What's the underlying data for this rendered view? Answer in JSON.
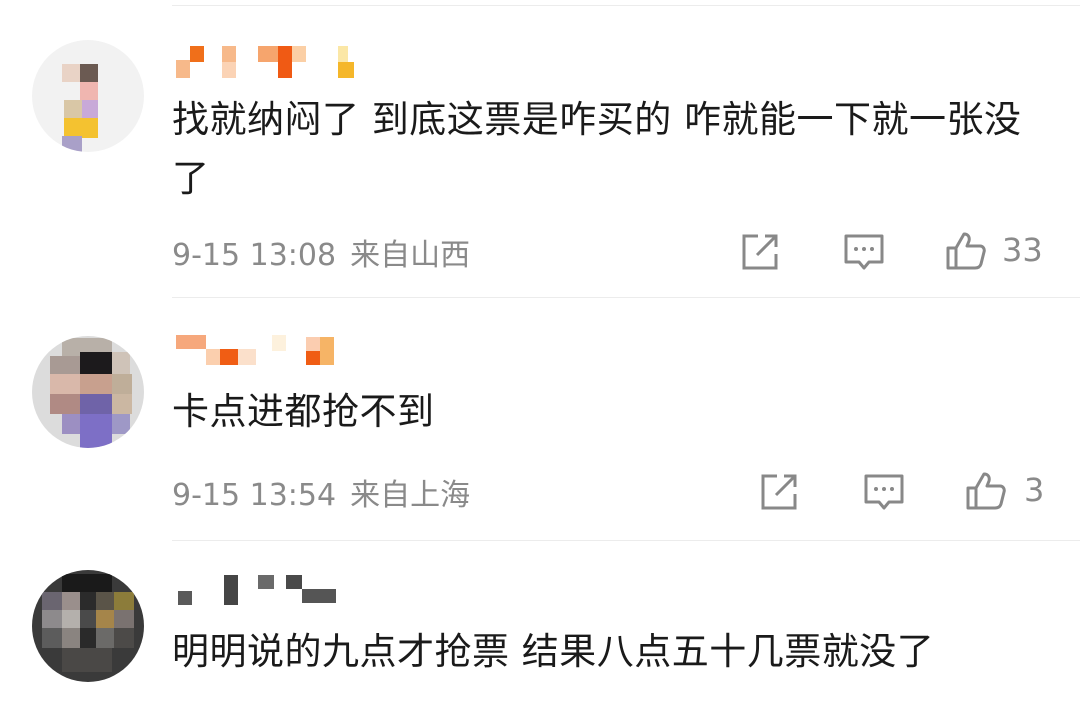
{
  "comments": [
    {
      "username": "",
      "text": "找就纳闷了 到底这票是咋买的 咋就能一下就一张没了",
      "date": "9-15 13:08",
      "location": "来自山西",
      "likes": "33"
    },
    {
      "username": "",
      "text": "卡点进都抢不到",
      "date": "9-15 13:54",
      "location": "来自上海",
      "likes": "3"
    },
    {
      "username": "",
      "text": "明明说的九点才抢票 结果八点五十几票就没了",
      "date": "",
      "location": "",
      "likes": ""
    }
  ],
  "icons": {
    "share": "share-icon",
    "reply": "comment-icon",
    "like": "thumbs-up-icon"
  },
  "colors": {
    "text": "#1a1a1a",
    "meta": "#8a8a8a",
    "icon": "#888888",
    "divider": "#ececec"
  }
}
